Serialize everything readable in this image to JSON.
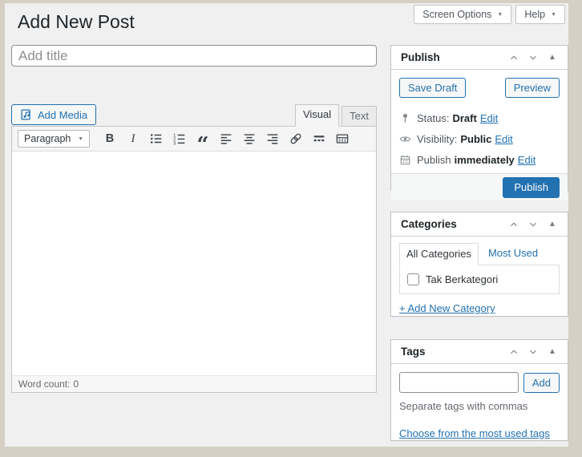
{
  "page": {
    "title": "Add New Post",
    "screen_options_label": "Screen Options",
    "help_label": "Help"
  },
  "icons": {
    "caret_down": "▼",
    "collapse_triangle": "▲"
  },
  "editor": {
    "title_placeholder": "Add title",
    "title_value": "",
    "add_media_label": "Add Media",
    "tabs": {
      "visual": "Visual",
      "text": "Text"
    },
    "toolbar": {
      "paragraph_label": "Paragraph",
      "bold_glyph": "B",
      "italic_glyph": "I",
      "blockquote_glyph": "“",
      "buttons": [
        "paragraph-style",
        "bold",
        "italic",
        "bulleted-list",
        "numbered-list",
        "blockquote",
        "align-left",
        "align-center",
        "align-right",
        "insert-link",
        "read-more",
        "toolbar-toggle"
      ]
    },
    "content_text": "",
    "word_count_label": "Word count:",
    "word_count_value": "0"
  },
  "publish_panel": {
    "title": "Publish",
    "save_draft_label": "Save Draft",
    "preview_label": "Preview",
    "rows": {
      "status_label": "Status:",
      "status_value": "Draft",
      "visibility_label": "Visibility:",
      "visibility_value": "Public",
      "schedule_label": "Publish",
      "schedule_value": "immediately"
    },
    "edit_label": "Edit",
    "publish_button_label": "Publish"
  },
  "categories_panel": {
    "title": "Categories",
    "tabs": {
      "all": "All Categories",
      "most_used": "Most Used"
    },
    "items": [
      {
        "label": "Tak Berkategori",
        "checked": false
      }
    ],
    "add_new_label": "+ Add New Category"
  },
  "tags_panel": {
    "title": "Tags",
    "input_value": "",
    "add_button_label": "Add",
    "hint": "Separate tags with commas",
    "choose_link_label": "Choose from the most used tags"
  },
  "colors": {
    "accent": "#2271b1",
    "background": "#f0f0f1",
    "frame": "#d6d0c4",
    "panel_border": "#c3c4c7"
  }
}
